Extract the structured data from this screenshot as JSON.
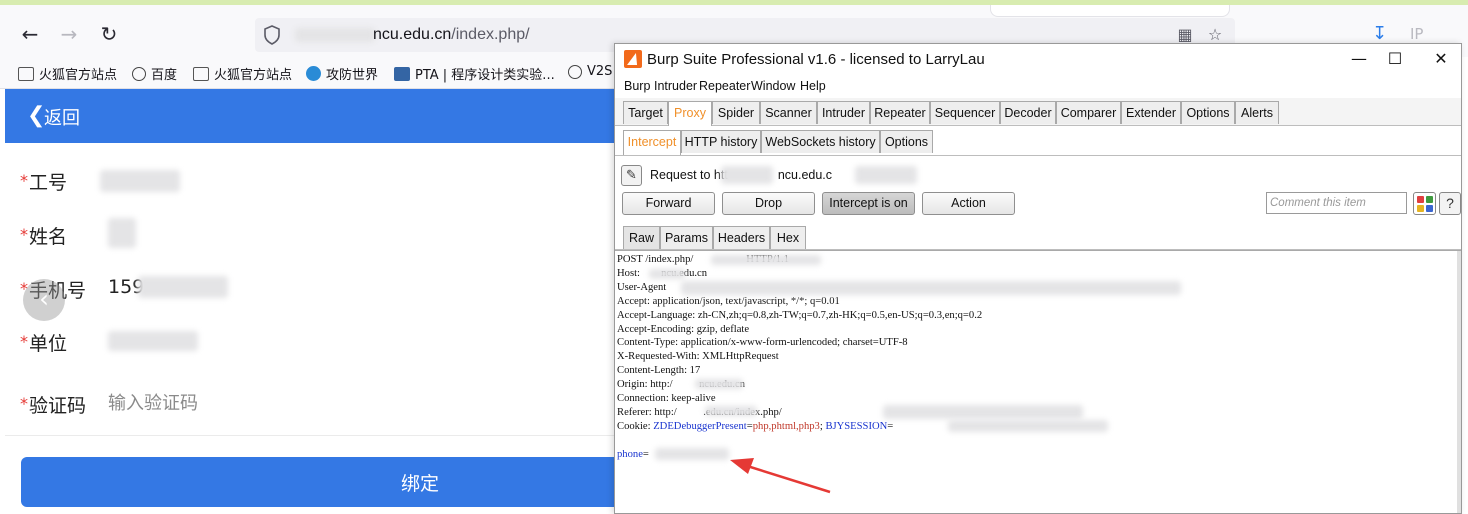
{
  "browser": {
    "url_host": "ncu.edu.cn",
    "url_path": "/index.php/",
    "toolbar_right_label": "IP",
    "bookmarks": [
      {
        "label": "火狐官方站点",
        "icon": "folder-icon"
      },
      {
        "label": "百度",
        "icon": "globe-icon"
      },
      {
        "label": "火狐官方站点",
        "icon": "folder-icon"
      },
      {
        "label": "攻防世界",
        "icon": "site-icon"
      },
      {
        "label": "PTA | 程序设计类实验...",
        "icon": "pta-icon"
      },
      {
        "label": "V2S",
        "icon": "globe-icon"
      }
    ]
  },
  "page": {
    "back_label": "返回",
    "fields": [
      {
        "label": "工号",
        "value": ""
      },
      {
        "label": "姓名",
        "value": ""
      },
      {
        "label": "手机号",
        "value": "159"
      },
      {
        "label": "单位",
        "value": ""
      },
      {
        "label": "验证码",
        "placeholder": "输入验证码"
      }
    ],
    "submit_label": "绑定",
    "required_mark": "*"
  },
  "burp": {
    "title": "Burp Suite Professional v1.6 - licensed to LarryLau",
    "menu": [
      "Burp",
      "Intruder",
      "Repeater",
      "Window",
      "Help"
    ],
    "main_tabs": [
      "Target",
      "Proxy",
      "Spider",
      "Scanner",
      "Intruder",
      "Repeater",
      "Sequencer",
      "Decoder",
      "Comparer",
      "Extender",
      "Options",
      "Alerts"
    ],
    "main_tab_active": "Proxy",
    "proxy_tabs": [
      "Intercept",
      "HTTP history",
      "WebSockets history",
      "Options"
    ],
    "proxy_tab_active": "Intercept",
    "request_to_prefix": "Request to htt",
    "request_to_host": "ncu.edu.c",
    "buttons": {
      "forward": "Forward",
      "drop": "Drop",
      "intercept": "Intercept is on",
      "action": "Action"
    },
    "comment_placeholder": "Comment this item",
    "help_label": "?",
    "view_tabs": [
      "Raw",
      "Params",
      "Headers",
      "Hex"
    ],
    "view_tab_active": "Raw",
    "request_lines": [
      "POST /index.php/                    HTTP/1.1",
      "Host:        ncu.edu.cn",
      "User-Agent",
      "Accept: application/json, text/javascript, */*; q=0.01",
      "Accept-Language: zh-CN,zh;q=0.8,zh-TW;q=0.7,zh-HK;q=0.5,en-US;q=0.3,en;q=0.2",
      "Accept-Encoding: gzip, deflate",
      "Content-Type: application/x-www-form-urlencoded; charset=UTF-8",
      "X-Requested-With: XMLHttpRequest",
      "Content-Length: 17",
      "Origin: http:/          ncu.edu.cn",
      "Connection: keep-alive",
      "Referer: http:/          .edu.cn/index.php/",
      "Cookie: ZDEDebuggerPresent=php,phtml,php3; BJYSESSION=",
      "",
      "phone="
    ],
    "cookie_param": "ZDEDebuggerPresent",
    "cookie_value": "php,phtml,php3",
    "cookie_param2": "BJYSESSION",
    "body_param": "phone"
  },
  "colors": {
    "accent_blue": "#3478e4",
    "burp_orange": "#f0902a",
    "annotation_arrow": "#e53935"
  }
}
